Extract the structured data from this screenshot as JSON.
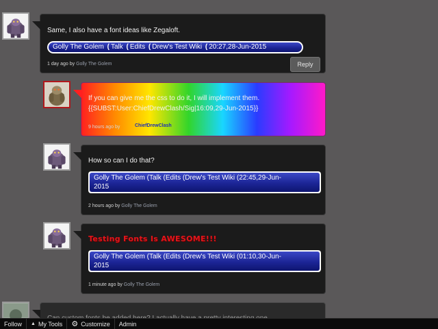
{
  "comments": [
    {
      "message": "Same, I also have a font ideas like Zegaloft.",
      "signature": {
        "name": "Golly The Golem",
        "talk": "Talk",
        "edits": "Edits",
        "wiki": "Drew's Test Wiki",
        "timestamp": "20:27,28-Jun-2015"
      },
      "time": "1 day ago",
      "by": "by",
      "author": "Golly The Golem",
      "reply_label": "Reply"
    },
    {
      "message_line1": "If you can give me the css to do it, I will implement them.",
      "message_line2": "{{SUBST:User:ChiefDrewClash/Sig|16:09,29-Jun-2015}}",
      "time": "9 hours ago",
      "by": "by",
      "author_wordmark": "ChiefDrewClash"
    },
    {
      "message": "How so can I do that?",
      "signature": {
        "name": "Golly The Golem",
        "talk": "Talk",
        "edits": "Edits",
        "wiki": "Drew's Test Wiki",
        "timestamp": "22:45,29-Jun-",
        "year": "2015"
      },
      "time": "2 hours ago",
      "by": "by",
      "author": "Golly The Golem"
    },
    {
      "fancy_text": "Testing Fonts Is AWESOME!!!",
      "signature": {
        "name": "Golly The Golem",
        "talk": "Talk",
        "edits": "Edits",
        "wiki": "Drew's Test Wiki",
        "timestamp": "01:10,30-Jun-",
        "year": "2015"
      },
      "time": "1 minute ago",
      "by": "by",
      "author": "Golly The Golem"
    },
    {
      "message": "Can custom fonts be added here? I actually have a pretty interesting one..."
    }
  ],
  "toolbar": {
    "follow": "Follow",
    "my_tools": "My Tools",
    "customize": "Customize",
    "admin": "Admin"
  },
  "colors": {
    "page_bg": "#5a5859",
    "bubble_bg": "#1b1b1b",
    "signature_blue": "#1c2596",
    "fancy_red": "#e0161c"
  }
}
